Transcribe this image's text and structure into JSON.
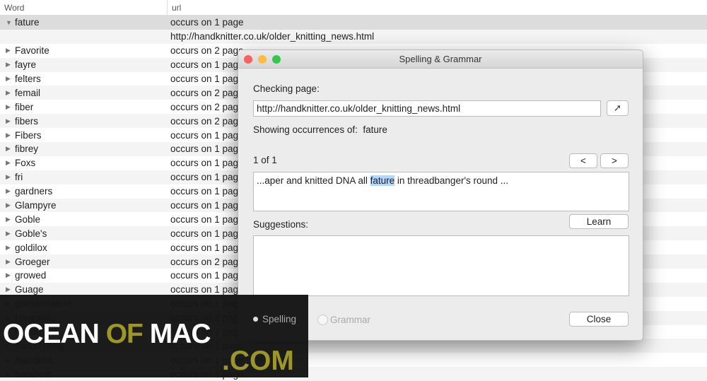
{
  "table": {
    "headers": [
      "Word",
      "url"
    ],
    "expanded": {
      "word": "fature",
      "count": "occurs on 1 page",
      "url": "http://handknitter.co.uk/older_knitting_news.html"
    },
    "rows": [
      [
        "Favorite",
        "occurs on 2 page"
      ],
      [
        "fayre",
        "occurs on 1 page"
      ],
      [
        "felters",
        "occurs on 1 page"
      ],
      [
        "femail",
        "occurs on 2 page"
      ],
      [
        "fiber",
        "occurs on 2 page"
      ],
      [
        "fibers",
        "occurs on 2 page"
      ],
      [
        "Fibers",
        "occurs on 1 page"
      ],
      [
        "fibrey",
        "occurs on 1 page"
      ],
      [
        "Foxs",
        "occurs on 1 page"
      ],
      [
        "fri",
        "occurs on 1 page"
      ],
      [
        "gardners",
        "occurs on 1 page"
      ],
      [
        "Glampyre",
        "occurs on 1 page"
      ],
      [
        "Goble",
        "occurs on 1 page"
      ],
      [
        "Goble's",
        "occurs on 1 page"
      ],
      [
        "goldilox",
        "occurs on 1 page"
      ],
      [
        "Groeger",
        "occurs on 2 page"
      ],
      [
        "growed",
        "occurs on 1 page"
      ],
      [
        "Guage",
        "occurs on 1 page"
      ],
      [
        "guessimation",
        "occurs on 1 page"
      ],
      [
        "Haapsalu",
        "occurs on 2 page"
      ],
      [
        "handdyed",
        "occurs on 1 page"
      ],
      [
        "handdyeing",
        "occurs on 1 page"
      ],
      [
        "Handknit",
        "occurs on 1 page"
      ],
      [
        "handknit",
        "occurs on 1 page"
      ]
    ]
  },
  "dialog": {
    "title": "Spelling & Grammar",
    "checking_label": "Checking page:",
    "url": "http://handknitter.co.uk/older_knitting_news.html",
    "showing_label": "Showing occurrences of:",
    "word": "fature",
    "counter": "1 of 1",
    "prev": "<",
    "next": ">",
    "context_before": "...aper and knitted DNA all ",
    "context_word": "fature",
    "context_after": " in threadbanger's round ...",
    "suggestions_label": "Suggestions:",
    "learn": "Learn",
    "spelling": "Spelling",
    "grammar": "Grammar",
    "close": "Close"
  },
  "watermark": {
    "text1": "OCEAN",
    "text2": "OF",
    "text3": "MAC",
    "text4": ".COM"
  }
}
